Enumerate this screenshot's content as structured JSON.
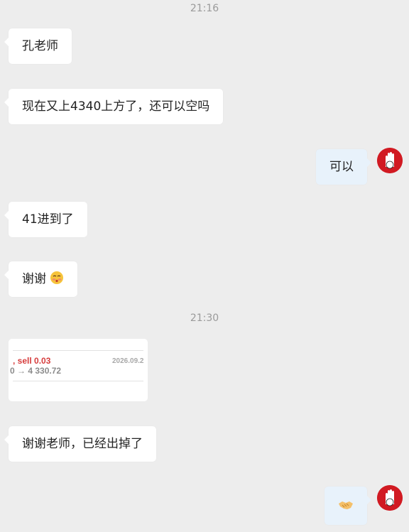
{
  "timestamps": [
    "21:16",
    "21:30"
  ],
  "messages": [
    {
      "side": "left",
      "text": "孔老师"
    },
    {
      "side": "left",
      "text": "现在又上4340上方了，还可以空吗"
    },
    {
      "side": "right",
      "text": "可以"
    },
    {
      "side": "left",
      "text": "41进到了"
    },
    {
      "side": "left",
      "text": "谢谢"
    },
    {
      "side": "left",
      "text": "谢谢老师，已经出掉了"
    }
  ],
  "emojis": {
    "after_thanks": "blushing-face-icon",
    "last_reply": "handshake-icon"
  },
  "trade_card": {
    "action": ", sell 0.03",
    "price": "0 → 4 330.72",
    "date": "2026.09.2"
  },
  "colors": {
    "background": "#ededed",
    "bubble_left": "#ffffff",
    "bubble_right": "#e8f2fb",
    "avatar": "#d11a22",
    "sell": "#d63c3c"
  }
}
